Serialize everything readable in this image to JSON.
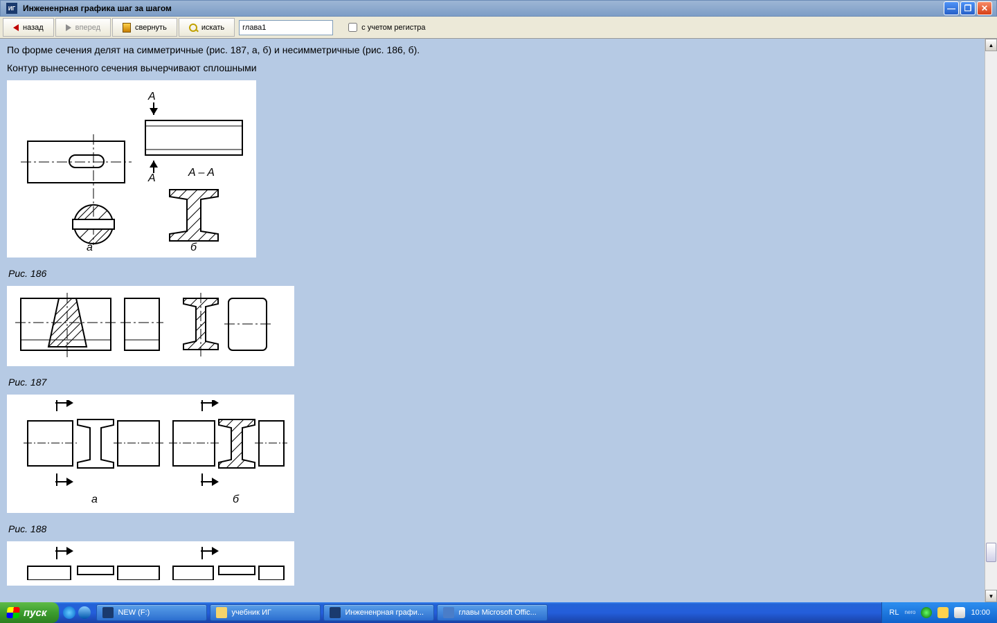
{
  "window": {
    "title": "Инжененрная графика шаг за шагом",
    "app_icon": "ИГ"
  },
  "toolbar": {
    "back": "назад",
    "forward": "вперед",
    "collapse": "свернуть",
    "search": "искать",
    "search_value": "глава1",
    "case_sensitive": "с учетом регистра"
  },
  "content": {
    "p1": "По форме сечения делят на симметричные (рис. 187, а, б) и несимметричные (рис. 186, б).",
    "p2": "Контур вынесенного сечения вычерчивают сплошными",
    "cap186": "Рис. 186",
    "cap187": "Рис. 187",
    "cap188": "Рис. 188",
    "lbl_a": "а",
    "lbl_b": "б",
    "lbl_A": "A",
    "lbl_AA": "A – A"
  },
  "taskbar": {
    "start": "пуск",
    "items": [
      {
        "label": "NEW (F:)"
      },
      {
        "label": "учебник ИГ"
      },
      {
        "label": "Инжененрная графи..."
      },
      {
        "label": "главы Microsoft Offic..."
      }
    ],
    "lang": "RL",
    "nero": "nero",
    "clock": "10:00"
  }
}
